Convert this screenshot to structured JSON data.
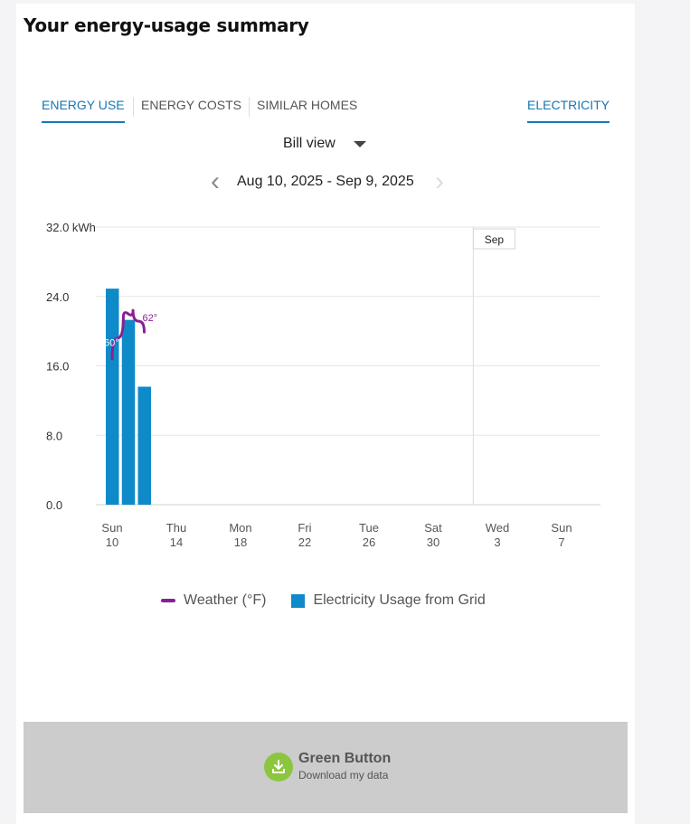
{
  "page": {
    "title": "Your energy-usage summary"
  },
  "tabs": [
    {
      "label": "ENERGY USE",
      "active": true
    },
    {
      "label": "ENERGY COSTS",
      "active": false
    },
    {
      "label": "SIMILAR HOMES",
      "active": false
    }
  ],
  "fuel_tab": {
    "label": "ELECTRICITY",
    "active": true
  },
  "view_select": {
    "value": "Bill view"
  },
  "date_nav": {
    "range": "Aug 10, 2025 - Sep 9, 2025",
    "prev_enabled": true,
    "next_enabled": false
  },
  "chart_data": {
    "type": "bar",
    "unit": "kWh",
    "ylim": [
      0,
      32
    ],
    "y_ticks": [
      0,
      8,
      16,
      24,
      32
    ],
    "y_tick_labels": [
      "0.0",
      "8.0",
      "16.0",
      "24.0",
      "32.0 kWh"
    ],
    "x_ticks": [
      {
        "day": 0,
        "top": "Sun",
        "bottom": "10"
      },
      {
        "day": 4,
        "top": "Thu",
        "bottom": "14"
      },
      {
        "day": 8,
        "top": "Mon",
        "bottom": "18"
      },
      {
        "day": 12,
        "top": "Fri",
        "bottom": "22"
      },
      {
        "day": 16,
        "top": "Tue",
        "bottom": "26"
      },
      {
        "day": 20,
        "top": "Sat",
        "bottom": "30"
      },
      {
        "day": 24,
        "top": "Wed",
        "bottom": "3"
      },
      {
        "day": 28,
        "top": "Sun",
        "bottom": "7"
      }
    ],
    "x_range": [
      "Aug 10, 2025",
      "Sep 9, 2025"
    ],
    "month_marker": {
      "label": "Sep",
      "day": 22.5
    },
    "series": [
      {
        "name": "Electricity Usage from Grid",
        "color": "#0e8ac9",
        "points": [
          {
            "date": "Aug 10, 2025",
            "day": 0,
            "value": 24.9
          },
          {
            "date": "Aug 11, 2025",
            "day": 1,
            "value": 21.3
          },
          {
            "date": "Aug 12, 2025",
            "day": 2,
            "value": 13.6
          }
        ]
      },
      {
        "name": "Weather (°F)",
        "color": "#8a1f93",
        "line": [
          {
            "day": 0,
            "value": 16.8
          },
          {
            "day": 0.7,
            "value": 21.6
          },
          {
            "day": 1.3,
            "value": 22.4
          },
          {
            "day": 2,
            "value": 19.9
          }
        ],
        "labels": [
          {
            "text": "60°",
            "day": 0,
            "value": 18.7,
            "color": "#ffffff"
          },
          {
            "text": "62°",
            "day": 2,
            "value": 21.6,
            "color": "#8a1f93"
          }
        ]
      }
    ]
  },
  "legend": [
    {
      "label": "Weather (°F)",
      "color": "#8a1f93",
      "shape": "line"
    },
    {
      "label": "Electricity Usage from Grid",
      "color": "#0e8ac9",
      "shape": "square"
    }
  ],
  "green_button": {
    "title": "Green Button",
    "subtitle": "Download my data",
    "icon": "download-icon",
    "icon_color": "#8cc63f"
  }
}
